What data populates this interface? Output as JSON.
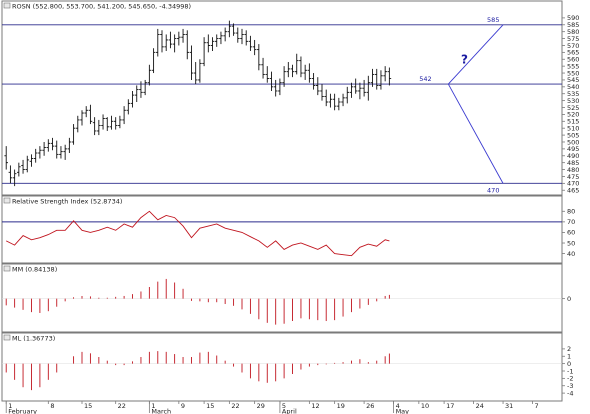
{
  "colors": {
    "price_bars": "#111111",
    "levels": "#2a2a8c",
    "projection": "#3a3ad0",
    "rsi_line": "#c0141e",
    "hist": "#c0141e",
    "frame": "#7a7a7a",
    "text_blue": "#1a1aa0"
  },
  "chart_data": [
    {
      "type": "ohlc",
      "title": "ROSN (552.800, 553.700, 541.200, 545.650, -4.34998)",
      "ylim": [
        463,
        595
      ],
      "yticks": [
        465,
        470,
        475,
        480,
        485,
        490,
        495,
        500,
        505,
        510,
        515,
        520,
        525,
        530,
        535,
        540,
        545,
        550,
        555,
        560,
        565,
        570,
        575,
        580,
        585,
        590
      ],
      "horizontal_levels": [
        585,
        542,
        470
      ],
      "level_labels": [
        {
          "text": "585",
          "value": 585
        },
        {
          "text": "542",
          "value": 542
        },
        {
          "text": "470",
          "value": 470
        }
      ],
      "projection_lines": [
        {
          "x": [
            105,
            118
          ],
          "y": [
            542,
            585
          ]
        },
        {
          "x": [
            105,
            118
          ],
          "y": [
            542,
            470
          ]
        }
      ],
      "marker_text": "?",
      "bars": [
        {
          "x": 0,
          "o": 490,
          "h": 497,
          "l": 480,
          "c": 485
        },
        {
          "x": 1,
          "o": 478,
          "h": 483,
          "l": 470,
          "c": 474
        },
        {
          "x": 2,
          "o": 474,
          "h": 480,
          "l": 468,
          "c": 477
        },
        {
          "x": 3,
          "o": 478,
          "h": 485,
          "l": 475,
          "c": 482
        },
        {
          "x": 4,
          "o": 483,
          "h": 487,
          "l": 477,
          "c": 480
        },
        {
          "x": 5,
          "o": 480,
          "h": 490,
          "l": 478,
          "c": 487
        },
        {
          "x": 6,
          "o": 486,
          "h": 491,
          "l": 482,
          "c": 488
        },
        {
          "x": 7,
          "o": 488,
          "h": 495,
          "l": 485,
          "c": 492
        },
        {
          "x": 8,
          "o": 492,
          "h": 497,
          "l": 488,
          "c": 494
        },
        {
          "x": 9,
          "o": 494,
          "h": 500,
          "l": 490,
          "c": 496
        },
        {
          "x": 10,
          "o": 496,
          "h": 502,
          "l": 493,
          "c": 499
        },
        {
          "x": 11,
          "o": 499,
          "h": 503,
          "l": 494,
          "c": 497
        },
        {
          "x": 12,
          "o": 497,
          "h": 501,
          "l": 488,
          "c": 491
        },
        {
          "x": 13,
          "o": 491,
          "h": 497,
          "l": 488,
          "c": 493
        },
        {
          "x": 14,
          "o": 493,
          "h": 498,
          "l": 487,
          "c": 495
        },
        {
          "x": 15,
          "o": 495,
          "h": 503,
          "l": 492,
          "c": 500
        },
        {
          "x": 16,
          "o": 500,
          "h": 513,
          "l": 498,
          "c": 510
        },
        {
          "x": 17,
          "o": 510,
          "h": 519,
          "l": 507,
          "c": 516
        },
        {
          "x": 18,
          "o": 516,
          "h": 523,
          "l": 512,
          "c": 521
        },
        {
          "x": 19,
          "o": 521,
          "h": 526,
          "l": 518,
          "c": 523
        },
        {
          "x": 20,
          "o": 523,
          "h": 527,
          "l": 513,
          "c": 515
        },
        {
          "x": 21,
          "o": 514,
          "h": 518,
          "l": 505,
          "c": 508
        },
        {
          "x": 22,
          "o": 508,
          "h": 516,
          "l": 505,
          "c": 512
        },
        {
          "x": 23,
          "o": 512,
          "h": 520,
          "l": 509,
          "c": 517
        },
        {
          "x": 24,
          "o": 517,
          "h": 518,
          "l": 508,
          "c": 511
        },
        {
          "x": 25,
          "o": 511,
          "h": 519,
          "l": 509,
          "c": 515
        },
        {
          "x": 26,
          "o": 515,
          "h": 518,
          "l": 509,
          "c": 512
        },
        {
          "x": 27,
          "o": 512,
          "h": 519,
          "l": 510,
          "c": 516
        },
        {
          "x": 28,
          "o": 516,
          "h": 526,
          "l": 513,
          "c": 523
        },
        {
          "x": 29,
          "o": 523,
          "h": 531,
          "l": 520,
          "c": 528
        },
        {
          "x": 30,
          "o": 528,
          "h": 537,
          "l": 525,
          "c": 534
        },
        {
          "x": 31,
          "o": 534,
          "h": 541,
          "l": 529,
          "c": 538
        },
        {
          "x": 32,
          "o": 538,
          "h": 544,
          "l": 532,
          "c": 536
        },
        {
          "x": 33,
          "o": 536,
          "h": 545,
          "l": 534,
          "c": 543
        },
        {
          "x": 34,
          "o": 543,
          "h": 556,
          "l": 541,
          "c": 552
        },
        {
          "x": 35,
          "o": 552,
          "h": 568,
          "l": 550,
          "c": 565
        },
        {
          "x": 36,
          "o": 565,
          "h": 582,
          "l": 562,
          "c": 578
        },
        {
          "x": 37,
          "o": 578,
          "h": 581,
          "l": 565,
          "c": 569
        },
        {
          "x": 38,
          "o": 569,
          "h": 578,
          "l": 566,
          "c": 574
        },
        {
          "x": 39,
          "o": 574,
          "h": 580,
          "l": 568,
          "c": 571
        },
        {
          "x": 40,
          "o": 571,
          "h": 578,
          "l": 565,
          "c": 575
        },
        {
          "x": 41,
          "o": 575,
          "h": 580,
          "l": 570,
          "c": 576
        },
        {
          "x": 42,
          "o": 576,
          "h": 582,
          "l": 572,
          "c": 578
        },
        {
          "x": 43,
          "o": 578,
          "h": 581,
          "l": 560,
          "c": 565
        },
        {
          "x": 44,
          "o": 565,
          "h": 570,
          "l": 545,
          "c": 550
        },
        {
          "x": 45,
          "o": 550,
          "h": 558,
          "l": 542,
          "c": 545
        },
        {
          "x": 46,
          "o": 545,
          "h": 560,
          "l": 543,
          "c": 557
        },
        {
          "x": 47,
          "o": 557,
          "h": 576,
          "l": 555,
          "c": 572
        },
        {
          "x": 48,
          "o": 572,
          "h": 578,
          "l": 565,
          "c": 570
        },
        {
          "x": 49,
          "o": 570,
          "h": 576,
          "l": 566,
          "c": 573
        },
        {
          "x": 50,
          "o": 573,
          "h": 578,
          "l": 569,
          "c": 575
        },
        {
          "x": 51,
          "o": 575,
          "h": 580,
          "l": 571,
          "c": 577
        },
        {
          "x": 52,
          "o": 577,
          "h": 583,
          "l": 573,
          "c": 580
        },
        {
          "x": 53,
          "o": 580,
          "h": 588,
          "l": 576,
          "c": 584
        },
        {
          "x": 54,
          "o": 584,
          "h": 586,
          "l": 577,
          "c": 579
        },
        {
          "x": 55,
          "o": 579,
          "h": 583,
          "l": 572,
          "c": 575
        },
        {
          "x": 56,
          "o": 575,
          "h": 582,
          "l": 571,
          "c": 578
        },
        {
          "x": 57,
          "o": 578,
          "h": 581,
          "l": 570,
          "c": 573
        },
        {
          "x": 58,
          "o": 573,
          "h": 577,
          "l": 566,
          "c": 569
        },
        {
          "x": 59,
          "o": 569,
          "h": 574,
          "l": 563,
          "c": 567
        },
        {
          "x": 60,
          "o": 567,
          "h": 571,
          "l": 552,
          "c": 556
        },
        {
          "x": 61,
          "o": 556,
          "h": 561,
          "l": 546,
          "c": 549
        },
        {
          "x": 62,
          "o": 549,
          "h": 555,
          "l": 543,
          "c": 546
        },
        {
          "x": 63,
          "o": 546,
          "h": 551,
          "l": 537,
          "c": 540
        },
        {
          "x": 64,
          "o": 540,
          "h": 545,
          "l": 533,
          "c": 537
        },
        {
          "x": 65,
          "o": 537,
          "h": 546,
          "l": 534,
          "c": 543
        },
        {
          "x": 66,
          "o": 543,
          "h": 555,
          "l": 540,
          "c": 551
        },
        {
          "x": 67,
          "o": 551,
          "h": 558,
          "l": 547,
          "c": 553
        },
        {
          "x": 68,
          "o": 553,
          "h": 556,
          "l": 547,
          "c": 551
        },
        {
          "x": 69,
          "o": 551,
          "h": 564,
          "l": 549,
          "c": 559
        },
        {
          "x": 70,
          "o": 559,
          "h": 562,
          "l": 547,
          "c": 550
        },
        {
          "x": 71,
          "o": 550,
          "h": 556,
          "l": 545,
          "c": 552
        },
        {
          "x": 72,
          "o": 552,
          "h": 557,
          "l": 543,
          "c": 546
        },
        {
          "x": 73,
          "o": 546,
          "h": 550,
          "l": 538,
          "c": 541
        },
        {
          "x": 74,
          "o": 541,
          "h": 547,
          "l": 534,
          "c": 537
        },
        {
          "x": 75,
          "o": 537,
          "h": 542,
          "l": 530,
          "c": 533
        },
        {
          "x": 76,
          "o": 533,
          "h": 538,
          "l": 526,
          "c": 529
        },
        {
          "x": 77,
          "o": 529,
          "h": 535,
          "l": 525,
          "c": 531
        },
        {
          "x": 78,
          "o": 531,
          "h": 535,
          "l": 523,
          "c": 526
        },
        {
          "x": 79,
          "o": 526,
          "h": 532,
          "l": 523,
          "c": 529
        },
        {
          "x": 80,
          "o": 529,
          "h": 535,
          "l": 526,
          "c": 532
        },
        {
          "x": 81,
          "o": 532,
          "h": 540,
          "l": 528,
          "c": 536
        },
        {
          "x": 82,
          "o": 536,
          "h": 543,
          "l": 532,
          "c": 540
        },
        {
          "x": 83,
          "o": 540,
          "h": 546,
          "l": 535,
          "c": 537
        },
        {
          "x": 84,
          "o": 537,
          "h": 543,
          "l": 531,
          "c": 539
        },
        {
          "x": 85,
          "o": 539,
          "h": 545,
          "l": 533,
          "c": 536
        },
        {
          "x": 86,
          "o": 536,
          "h": 548,
          "l": 530,
          "c": 543
        },
        {
          "x": 87,
          "o": 543,
          "h": 553,
          "l": 540,
          "c": 549
        },
        {
          "x": 88,
          "o": 549,
          "h": 553,
          "l": 538,
          "c": 541
        },
        {
          "x": 89,
          "o": 541,
          "h": 552,
          "l": 538,
          "c": 548
        },
        {
          "x": 90,
          "o": 548,
          "h": 555,
          "l": 544,
          "c": 551
        },
        {
          "x": 91,
          "o": 551,
          "h": 554,
          "l": 541,
          "c": 546
        }
      ]
    },
    {
      "type": "line",
      "title": "Relative Strength Index (52.8734)",
      "ylim": [
        33,
        85
      ],
      "yticks": [
        40,
        50,
        60,
        70,
        80
      ],
      "horizontal_levels": [
        70
      ],
      "x": [
        0,
        2,
        4,
        6,
        8,
        10,
        12,
        14,
        16,
        18,
        20,
        22,
        24,
        26,
        28,
        30,
        32,
        34,
        36,
        38,
        40,
        42,
        44,
        46,
        48,
        50,
        52,
        54,
        56,
        58,
        60,
        62,
        64,
        66,
        68,
        70,
        72,
        74,
        76,
        78,
        80,
        82,
        84,
        86,
        88,
        90,
        91
      ],
      "values": [
        52,
        48,
        57,
        53,
        55,
        58,
        62,
        62,
        71,
        62,
        60,
        62,
        65,
        62,
        68,
        65,
        74,
        80,
        72,
        76,
        74,
        66,
        55,
        64,
        66,
        68,
        64,
        62,
        60,
        56,
        52,
        46,
        52,
        44,
        48,
        50,
        47,
        44,
        48,
        40,
        39,
        38,
        46,
        49,
        47,
        53,
        52
      ]
    },
    {
      "type": "bar",
      "title": "MM (0.84138)",
      "ylim": [
        -7,
        5.5
      ],
      "yticks": [
        0
      ],
      "x": [
        0,
        2,
        4,
        6,
        8,
        10,
        12,
        14,
        16,
        18,
        20,
        22,
        24,
        26,
        28,
        30,
        32,
        34,
        36,
        38,
        40,
        42,
        44,
        46,
        48,
        50,
        52,
        54,
        56,
        58,
        60,
        62,
        64,
        66,
        68,
        70,
        72,
        74,
        76,
        78,
        80,
        82,
        84,
        86,
        88,
        90,
        91
      ],
      "values": [
        -1.5,
        -2.0,
        -2.5,
        -3.0,
        -3.2,
        -2.8,
        -1.8,
        -0.6,
        0.3,
        0.6,
        0.5,
        0.2,
        0.2,
        0.4,
        0.6,
        1.0,
        1.6,
        2.6,
        3.8,
        4.4,
        3.6,
        2.2,
        -0.5,
        -0.6,
        -0.8,
        -0.8,
        -1.2,
        -1.6,
        -2.4,
        -3.4,
        -4.6,
        -5.4,
        -5.8,
        -5.6,
        -5.0,
        -4.4,
        -4.6,
        -4.8,
        -5.0,
        -4.8,
        -4.0,
        -3.0,
        -2.2,
        -1.4,
        -0.6,
        0.6,
        0.84
      ]
    },
    {
      "type": "bar",
      "title": "ML (1.36773)",
      "ylim": [
        -4.8,
        2.8
      ],
      "yticks": [
        2,
        1,
        0,
        -1,
        -2,
        -3,
        -4
      ],
      "x": [
        0,
        2,
        4,
        6,
        8,
        10,
        12,
        14,
        16,
        18,
        20,
        22,
        24,
        26,
        28,
        30,
        32,
        34,
        36,
        38,
        40,
        42,
        44,
        46,
        48,
        50,
        52,
        54,
        56,
        58,
        60,
        62,
        64,
        66,
        68,
        70,
        72,
        74,
        76,
        78,
        80,
        82,
        84,
        86,
        88,
        90,
        91
      ],
      "values": [
        -1.2,
        -2.2,
        -3.2,
        -3.6,
        -3.2,
        -2.2,
        -1.2,
        0.0,
        1.0,
        1.6,
        1.4,
        0.9,
        0.4,
        -0.2,
        -0.2,
        0.3,
        0.9,
        1.6,
        1.7,
        1.6,
        1.3,
        0.9,
        0.9,
        1.5,
        1.6,
        1.1,
        0.4,
        -0.4,
        -1.2,
        -2.0,
        -2.4,
        -2.6,
        -2.4,
        -2.0,
        -1.4,
        -0.8,
        -0.4,
        -0.2,
        -0.1,
        0.1,
        0.2,
        0.4,
        0.6,
        0.2,
        0.4,
        1.0,
        1.37
      ]
    }
  ],
  "xaxis": {
    "domain": [
      -1,
      132
    ],
    "ticks": [
      {
        "label": "1",
        "x": 0
      },
      {
        "label": "8",
        "x": 10
      },
      {
        "label": "15",
        "x": 18
      },
      {
        "label": "22",
        "x": 26
      },
      {
        "label": "1",
        "x": 34
      },
      {
        "label": "9",
        "x": 41
      },
      {
        "label": "15",
        "x": 47
      },
      {
        "label": "22",
        "x": 53
      },
      {
        "label": "29",
        "x": 59
      },
      {
        "label": "5",
        "x": 65
      },
      {
        "label": "12",
        "x": 72
      },
      {
        "label": "19",
        "x": 78
      },
      {
        "label": "26",
        "x": 85
      },
      {
        "label": "4",
        "x": 92
      },
      {
        "label": "10",
        "x": 98
      },
      {
        "label": "17",
        "x": 104
      },
      {
        "label": "24",
        "x": 111
      },
      {
        "label": "31",
        "x": 118
      },
      {
        "label": "7",
        "x": 125
      }
    ],
    "months": [
      {
        "label": "February",
        "x": 0
      },
      {
        "label": "March",
        "x": 34
      },
      {
        "label": "April",
        "x": 65
      },
      {
        "label": "May",
        "x": 92
      }
    ]
  }
}
